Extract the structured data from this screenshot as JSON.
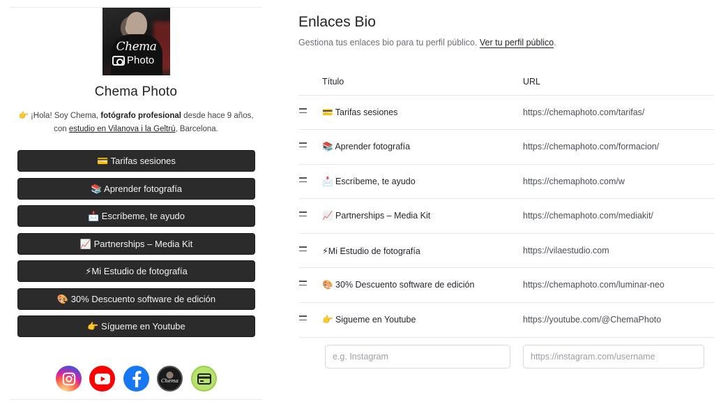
{
  "preview": {
    "avatar_logo_title": "Chema",
    "avatar_logo_sub": "Photo",
    "name": "Chema Photo",
    "bio": {
      "line1_prefix": "👉 ¡Hola! Soy Chema, ",
      "line1_bold": "fotógrafo profesional",
      "line1_suffix": " desde hace 9 años,",
      "line2_prefix": "con ",
      "line2_link": "estudio en Vilanova i la Geltrú",
      "line2_suffix": ", Barcelona."
    },
    "buttons": [
      "💳 Tarifas sesiones",
      "📚 Aprender fotografía",
      "📩 Escríbeme, te ayudo",
      "📈 Partnerships – Media Kit",
      "⚡Mi Estudio de fotografía",
      "🎨 30% Descuento software de edición",
      "👉 Sígueme en Youtube"
    ],
    "socials": [
      {
        "icon": "instagram-icon",
        "color": "#e1306c"
      },
      {
        "icon": "youtube-icon",
        "color": "#ff0000"
      },
      {
        "icon": "facebook-icon",
        "color": "#1877f2"
      },
      {
        "icon": "chema-photo-avatar-icon",
        "color": "#222222"
      },
      {
        "icon": "card-icon",
        "color": "#a8e063"
      }
    ]
  },
  "header": {
    "title": "Enlaces Bio",
    "subtitle": "Gestiona tus enlaces bio para tu perfil público.",
    "profile_link": "Ver tu perfil público",
    "subtitle_end": "."
  },
  "table": {
    "col_title": "Título",
    "col_url": "URL",
    "rows": [
      {
        "title": "💳 Tarifas sesiones",
        "url": "https://chemaphoto.com/tarifas/"
      },
      {
        "title": "📚 Aprender fotografía",
        "url": "https://chemaphoto.com/formacion/"
      },
      {
        "title": "📩 Escríbeme, te ayudo",
        "url": "https://chemaphoto.com/w"
      },
      {
        "title": "📈 Partnerships – Media Kit",
        "url": "https://chemaphoto.com/mediakit/"
      },
      {
        "title": "⚡Mi Estudio de fotografía",
        "url": "https://vilaestudio.com"
      },
      {
        "title": "🎨 30% Descuento software de edición",
        "url": "https://chemaphoto.com/luminar-neo"
      },
      {
        "title": "👉 Sigueme en Youtube",
        "url": "https://youtube.com/@ChemaPhoto"
      }
    ]
  },
  "new_link": {
    "title_value": "",
    "title_placeholder": "e.g. Instagram",
    "url_value": "",
    "url_placeholder": "https://instagram.com/username"
  }
}
